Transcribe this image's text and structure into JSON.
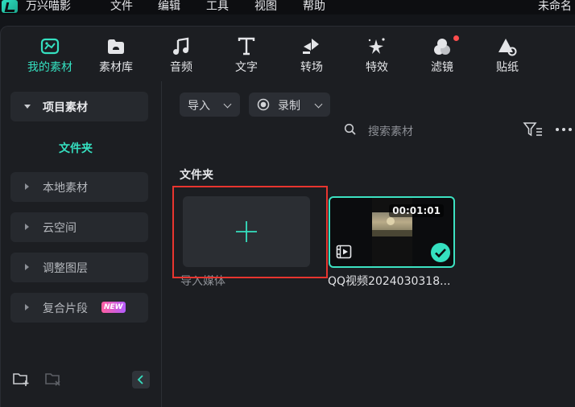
{
  "app": {
    "name": "万兴喵影",
    "project_name": "未命名"
  },
  "menu": [
    "文件",
    "编辑",
    "工具",
    "视图",
    "帮助"
  ],
  "toolbar": {
    "tabs": [
      {
        "label": "我的素材",
        "icon": "my-media-icon",
        "active": true
      },
      {
        "label": "素材库",
        "icon": "stock-media-icon"
      },
      {
        "label": "音频",
        "icon": "audio-icon"
      },
      {
        "label": "文字",
        "icon": "text-icon"
      },
      {
        "label": "转场",
        "icon": "transition-icon"
      },
      {
        "label": "特效",
        "icon": "effects-icon"
      },
      {
        "label": "滤镜",
        "icon": "filters-icon",
        "has_notification": true
      },
      {
        "label": "贴纸",
        "icon": "stickers-icon"
      }
    ]
  },
  "sidebar": {
    "items": [
      {
        "label": "项目素材",
        "expanded": true
      },
      {
        "label": "文件夹",
        "selected": true
      },
      {
        "label": "本地素材"
      },
      {
        "label": "云空间"
      },
      {
        "label": "调整图层"
      },
      {
        "label": "复合片段",
        "badge": "NEW"
      }
    ]
  },
  "media_panel": {
    "import_dropdown": "导入",
    "record_dropdown": "录制",
    "search_placeholder": "搜索素材",
    "section_title": "文件夹",
    "import_card_label": "导入媒体",
    "clips": [
      {
        "name": "QQ视频2024030318...",
        "duration": "00:01:01",
        "selected": true
      }
    ]
  },
  "colors": {
    "accent": "#35e0c0",
    "highlight_frame": "#e8352f",
    "notification": "#ff4d4d"
  }
}
